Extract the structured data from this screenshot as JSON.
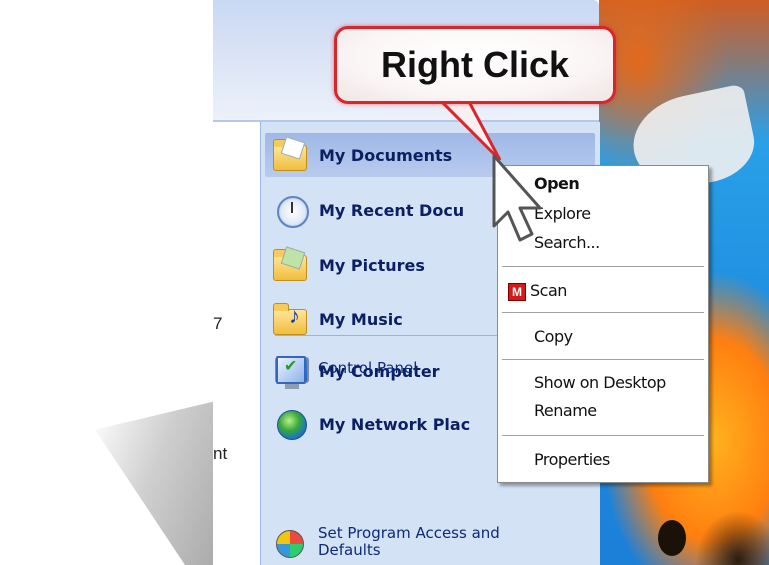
{
  "callout": {
    "text": "Right Click"
  },
  "left_column": {
    "fragments": [
      "7",
      "nt"
    ]
  },
  "start_menu": {
    "places": [
      {
        "label": "My Documents",
        "icon": "my-documents-folder-icon"
      },
      {
        "label": "My Recent Docu",
        "icon": "recent-documents-clock-icon"
      },
      {
        "label": "My Pictures",
        "icon": "my-pictures-folder-icon"
      },
      {
        "label": "My Music",
        "icon": "my-music-folder-icon"
      },
      {
        "label": "My Computer",
        "icon": "my-computer-monitor-icon"
      },
      {
        "label": "My Network Plac",
        "icon": "network-globe-icon"
      }
    ],
    "settings": [
      {
        "label": "Control Panel",
        "icon": "control-panel-icon"
      },
      {
        "label": "Set Program Access and Defaults",
        "icon": "program-access-icon"
      }
    ]
  },
  "context_menu": {
    "items": {
      "open": "Open",
      "explore": "Explore",
      "search": "Search...",
      "scan": "Scan",
      "scan_icon_letter": "M",
      "copy": "Copy",
      "show_on_desktop": "Show on Desktop",
      "rename": "Rename",
      "properties": "Properties"
    }
  },
  "colors": {
    "callout_border": "#d9262b",
    "menu_label": "#0b1f62",
    "right_pane": "#d4e2f6",
    "selection": "#9fb8e6"
  }
}
